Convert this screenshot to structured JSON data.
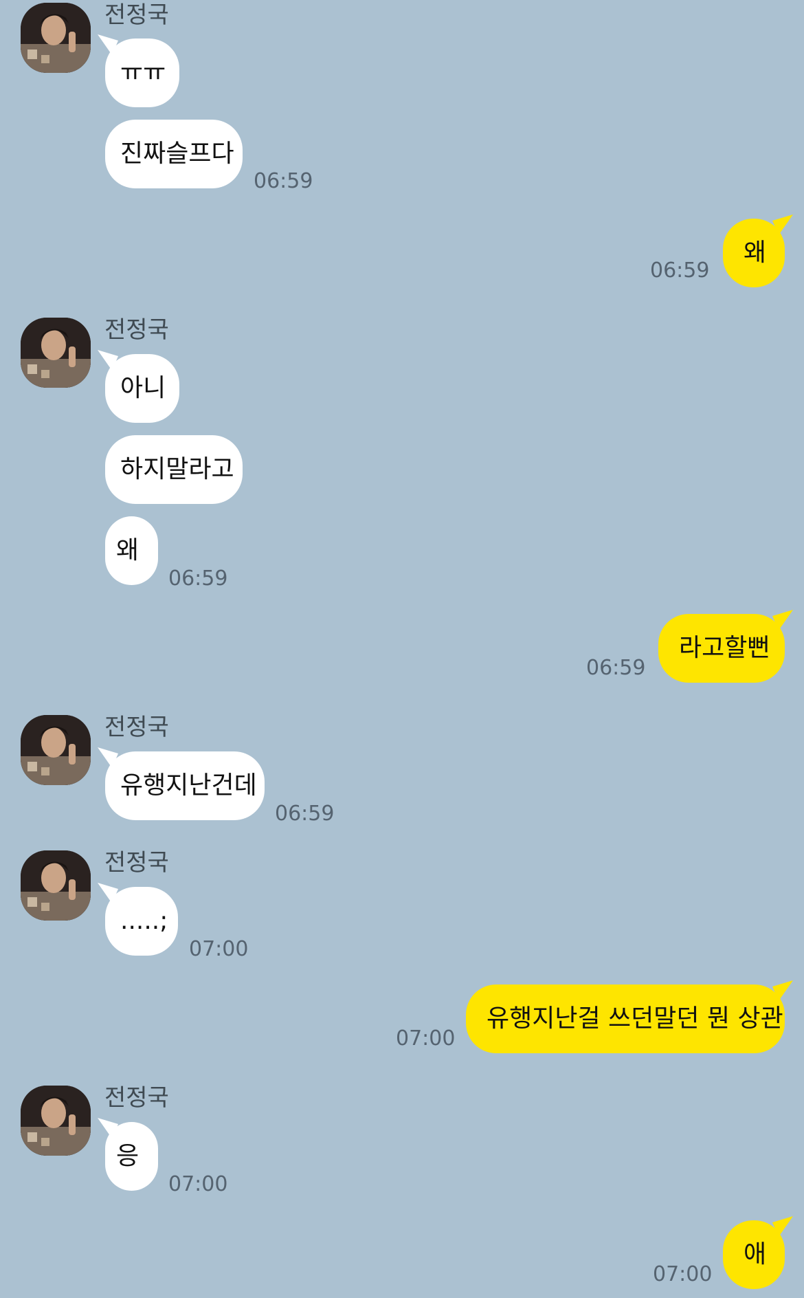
{
  "sender": {
    "name": "전정국"
  },
  "messages": [
    {
      "from": "other",
      "text": "ㅠㅠ"
    },
    {
      "from": "other",
      "text": "진짜슬프다",
      "time": "06:59"
    },
    {
      "from": "me",
      "text": "왜",
      "time": "06:59"
    },
    {
      "from": "other",
      "text": "아니"
    },
    {
      "from": "other",
      "text": "하지말라고"
    },
    {
      "from": "other",
      "text": "왜",
      "time": "06:59"
    },
    {
      "from": "me",
      "text": "라고할뻔",
      "time": "06:59"
    },
    {
      "from": "other",
      "text": "유행지난건데",
      "time": "06:59"
    },
    {
      "from": "other",
      "text": ".....;",
      "time": "07:00"
    },
    {
      "from": "me",
      "text": "유행지난걸 쓰던말던 뭔 상관",
      "time": "07:00"
    },
    {
      "from": "other",
      "text": "응",
      "time": "07:00"
    },
    {
      "from": "me",
      "text": "애",
      "time": "07:00"
    }
  ],
  "colors": {
    "background": "#abc1d1",
    "received_bubble": "#ffffff",
    "sent_bubble": "#fee500"
  },
  "icons": {
    "avatar": "profile-photo"
  }
}
